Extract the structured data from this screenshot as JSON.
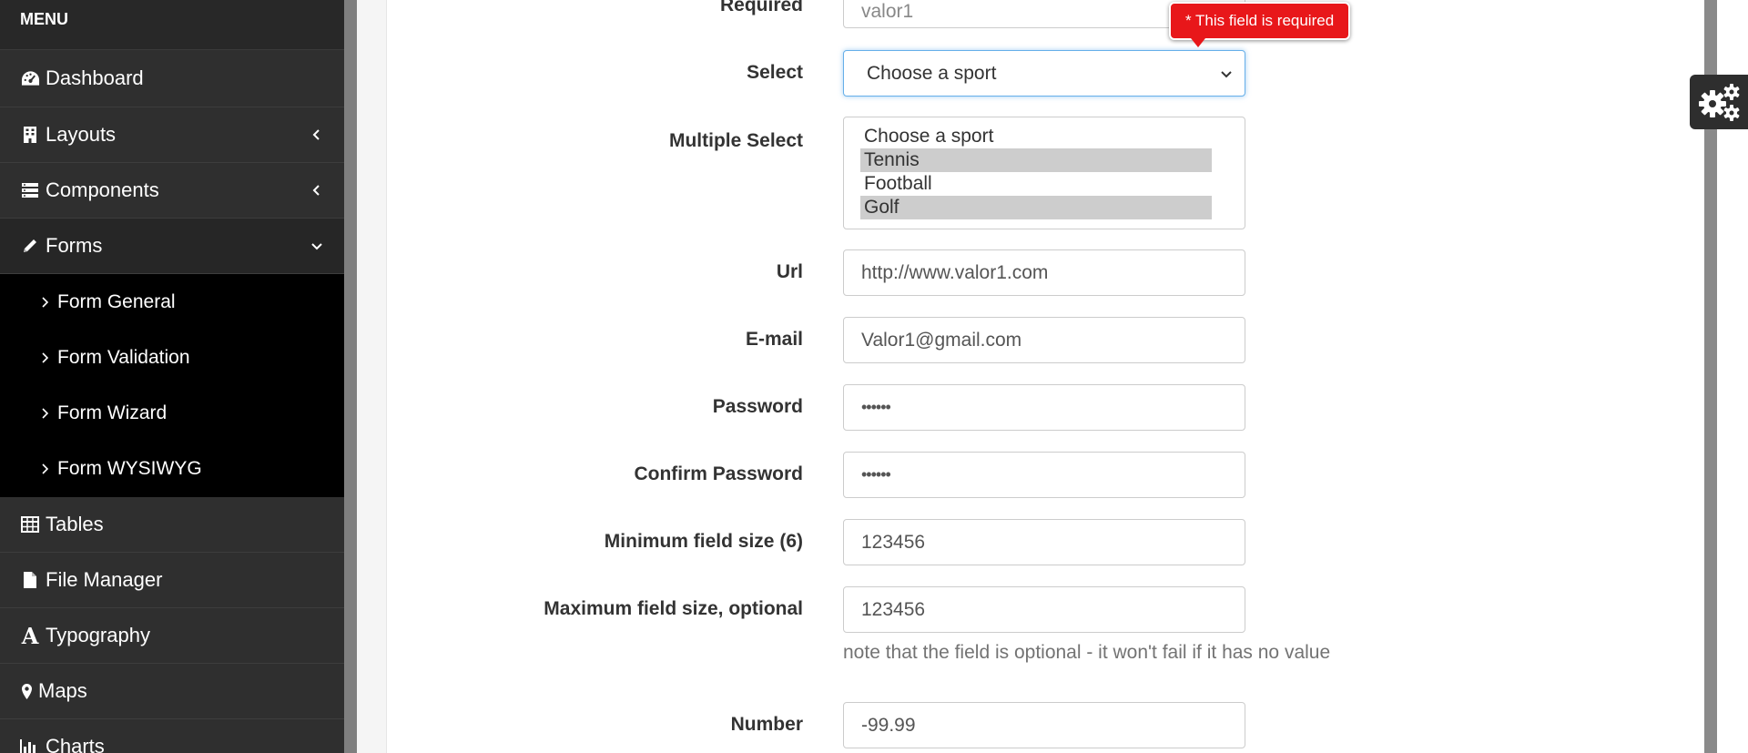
{
  "sidebar": {
    "menu_title": "MENU",
    "items": [
      {
        "label": "Dashboard",
        "icon": "dashboard-icon"
      },
      {
        "label": "Layouts",
        "icon": "building-icon",
        "caret": "left"
      },
      {
        "label": "Components",
        "icon": "list-icon",
        "caret": "left"
      },
      {
        "label": "Forms",
        "icon": "pencil-icon",
        "caret": "down"
      }
    ],
    "submenu": [
      "Form General",
      "Form Validation",
      "Form Wizard",
      "Form WYSIWYG"
    ],
    "items_after": [
      {
        "label": "Tables",
        "icon": "table-icon"
      },
      {
        "label": "File Manager",
        "icon": "file-icon"
      },
      {
        "label": "Typography",
        "icon": "font-icon"
      },
      {
        "label": "Maps",
        "icon": "map-marker-icon"
      },
      {
        "label": "Charts",
        "icon": "bar-chart-icon"
      }
    ]
  },
  "form": {
    "required": {
      "label": "Required",
      "value": "valor1"
    },
    "select": {
      "label": "Select",
      "value": "Choose a sport"
    },
    "multiple_select": {
      "label": "Multiple Select",
      "options": [
        "Choose a sport",
        "Tennis",
        "Football",
        "Golf"
      ],
      "selected": [
        "Tennis",
        "Golf"
      ]
    },
    "url": {
      "label": "Url",
      "value": "http://www.valor1.com"
    },
    "email": {
      "label": "E-mail",
      "value": "Valor1@gmail.com"
    },
    "password": {
      "label": "Password",
      "value": "••••••"
    },
    "confirm_password": {
      "label": "Confirm Password",
      "value": "••••••"
    },
    "min_size": {
      "label": "Minimum field size (6)",
      "value": "123456"
    },
    "max_size": {
      "label": "Maximum field size, optional",
      "value": "123456",
      "help": "note that the field is optional - it won't fail if it has no value"
    },
    "number": {
      "label": "Number",
      "value": "-99.99"
    }
  },
  "tooltip": {
    "text": "* This field is required",
    "color": "#e8171a"
  },
  "settings": {
    "icon": "gears-icon"
  }
}
